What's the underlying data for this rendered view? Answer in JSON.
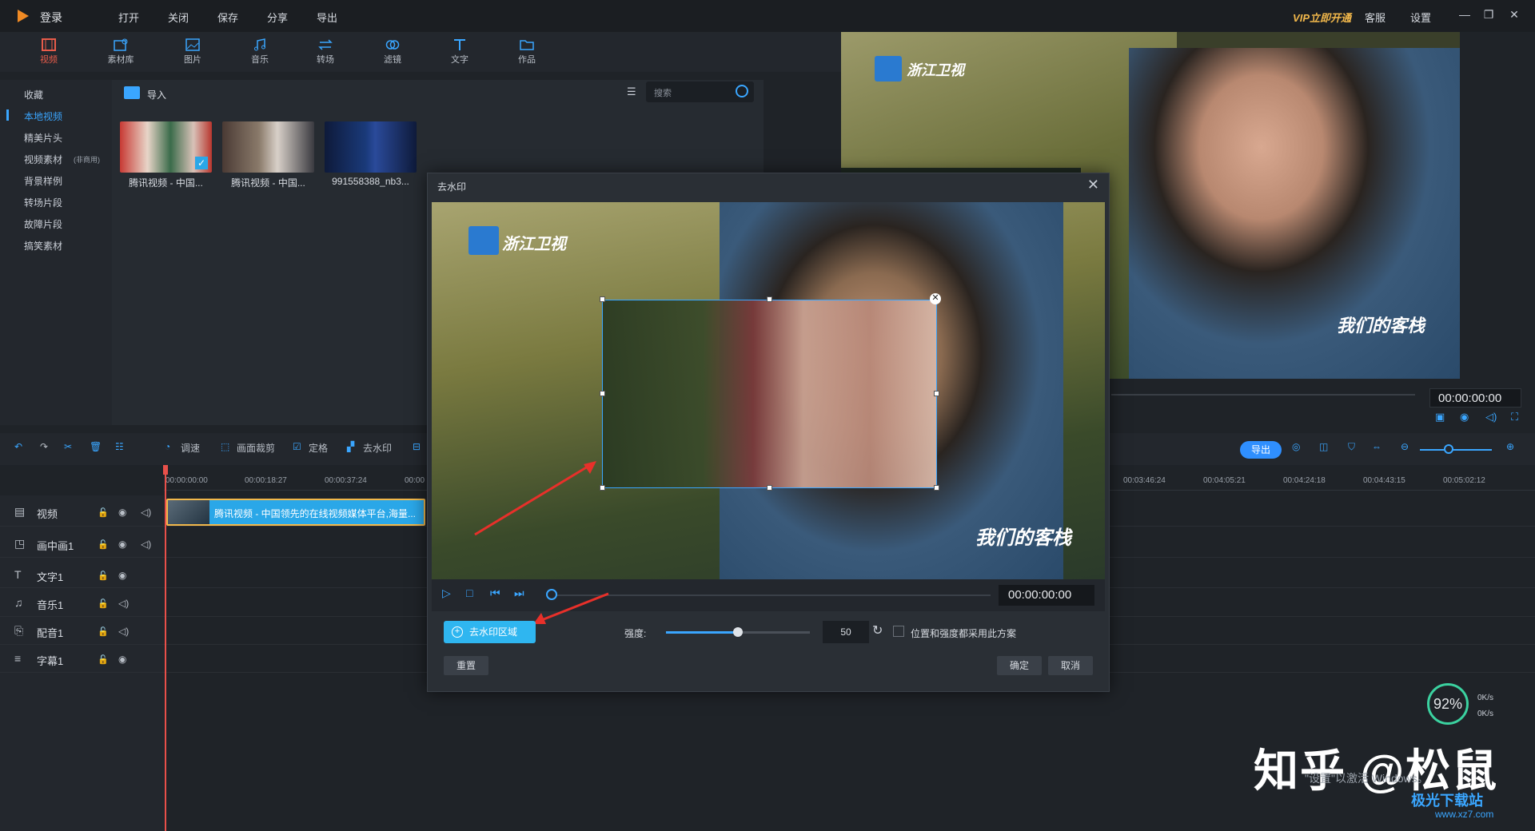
{
  "titlebar": {
    "login": "登录",
    "menu": [
      "打开",
      "关闭",
      "保存",
      "分享",
      "导出"
    ],
    "vip": "VIP立即开通",
    "service": "客服",
    "settings": "设置"
  },
  "toolbar": {
    "tools": [
      "视频",
      "素材库",
      "图片",
      "音乐",
      "转场",
      "滤镜",
      "文字",
      "作品"
    ],
    "active": "视频"
  },
  "sidebar": {
    "items": [
      "收藏",
      "本地视频",
      "精美片头",
      "视频素材",
      "背景样例",
      "转场片段",
      "故障片段",
      "搞笑素材"
    ],
    "active": "本地视频",
    "badge": "(非商用)"
  },
  "media": {
    "import_label": "导入",
    "search_placeholder": "搜索",
    "thumbs": [
      {
        "label": "腾讯视频 - 中国..."
      },
      {
        "label": "腾讯视频 - 中国..."
      },
      {
        "label": "991558388_nb3..."
      }
    ]
  },
  "preview": {
    "time": "00:00:00:00",
    "channel_logo": "浙江卫视",
    "show_logo": "我们的客栈"
  },
  "timeline_toolbar": {
    "tools": [
      "调速",
      "画面裁剪",
      "定格",
      "去水印"
    ],
    "export": "导出"
  },
  "ruler": {
    "ticks_left": [
      "00:00:00:00",
      "00:00:18:27",
      "00:00:37:24",
      "00:00"
    ],
    "ticks_right": [
      "00:03:46:24",
      "00:04:05:21",
      "00:04:24:18",
      "00:04:43:15",
      "00:05:02:12"
    ]
  },
  "tracks": [
    {
      "name": "视频"
    },
    {
      "name": "画中画1"
    },
    {
      "name": "文字1"
    },
    {
      "name": "音乐1"
    },
    {
      "name": "配音1"
    },
    {
      "name": "字幕1"
    }
  ],
  "clip": {
    "label": "腾讯视频 - 中国领先的在线视频媒体平台,海量..."
  },
  "dialog": {
    "title": "去水印",
    "time": "00:00:00:00",
    "add_area": "去水印区域",
    "strength_label": "强度:",
    "strength_value": "50",
    "strength_fraction": 0.5,
    "apply_all": "位置和强度都采用此方案",
    "reset": "重置",
    "ok": "确定",
    "cancel": "取消"
  },
  "overlay": {
    "watermark": "知乎 @松鼠",
    "windows_text": "\"设置\"以激活 Windows。",
    "gauge": "92%",
    "speed_up": "0K/s",
    "speed_down": "0K/s",
    "site": "极光下载站",
    "site_url": "www.xz7.com"
  },
  "colors": {
    "accent": "#3aa6ff",
    "active_tool": "#e85c4a",
    "clip": "#2aa7e8",
    "playhead": "#e8504a"
  }
}
